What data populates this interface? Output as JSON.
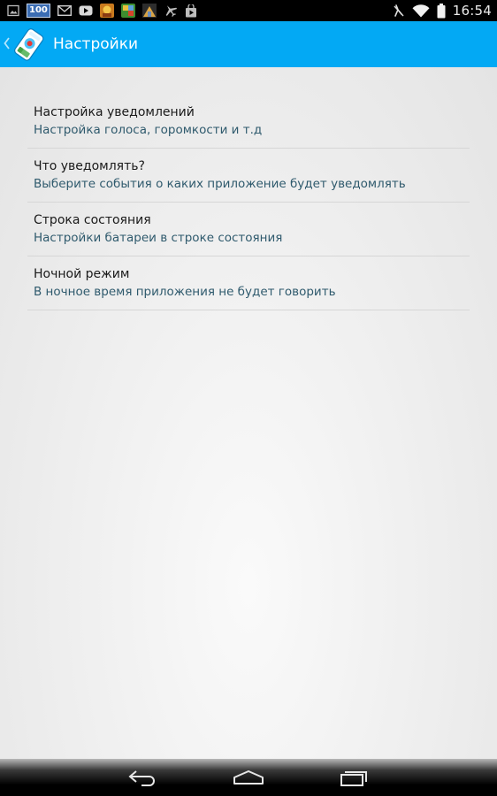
{
  "status_bar": {
    "time": "16:54",
    "notification_badge": "100",
    "left_icons": [
      "gallery-icon",
      "counter-badge-100",
      "gmail-icon",
      "youtube-icon",
      "game-icon-1",
      "game-icon-2",
      "game-icon-3",
      "airplane-icon",
      "play-store-icon"
    ],
    "right_icons": [
      "no-signal-icon",
      "wifi-icon",
      "battery-icon"
    ]
  },
  "action_bar": {
    "title": "Настройки",
    "background": "#03a9f4",
    "icons": [
      "up-chevron-icon",
      "app-logo-icon"
    ]
  },
  "preferences": [
    {
      "title": "Настройка уведомлений",
      "summary": "Настройка голоса, горомкости и т.д"
    },
    {
      "title": "Что уведомлять?",
      "summary": "Выберите события о каких приложение будет уведомлять"
    },
    {
      "title": "Строка состояния",
      "summary": "Настройки батареи в строке состояния"
    },
    {
      "title": "Ночной режим",
      "summary": "В ночное время приложения не будет говорить"
    }
  ],
  "nav_bar": {
    "buttons": [
      "back-icon",
      "home-icon",
      "recent-apps-icon"
    ]
  }
}
